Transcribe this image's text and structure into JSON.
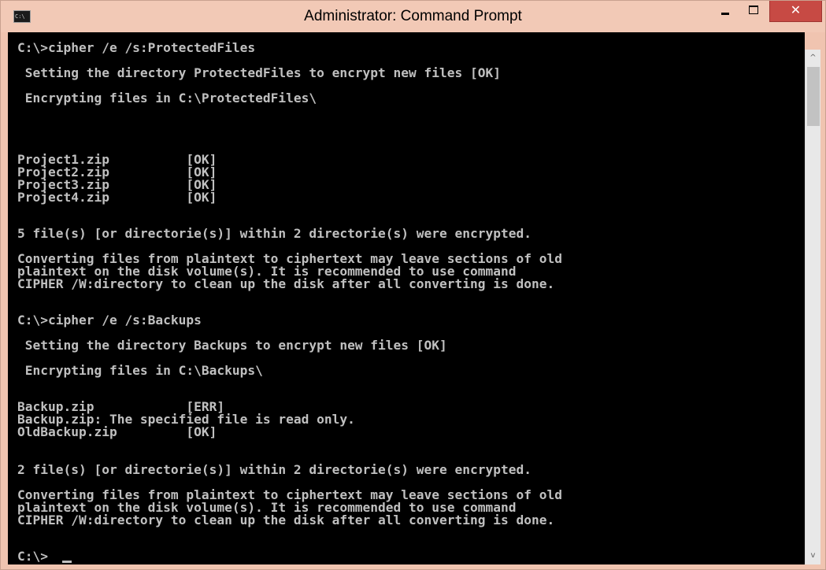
{
  "window": {
    "title": "Administrator: Command Prompt",
    "app_icon_label": "C:\\",
    "minimize_glyph": "–",
    "close_glyph": "✕",
    "icons": {
      "app": "cmd-icon",
      "minimize": "minimize-icon",
      "maximize": "maximize-icon",
      "close": "close-icon",
      "scroll_up": "scroll-up-arrow-icon",
      "scroll_down": "scroll-down-arrow-icon"
    },
    "colors": {
      "titlebar": "#f2c9b6",
      "close_button": "#c74a44",
      "console_background": "#000000",
      "console_text": "#c0c0c0"
    }
  },
  "console": {
    "lines": [
      "C:\\>cipher /e /s:ProtectedFiles",
      "",
      " Setting the directory ProtectedFiles to encrypt new files [OK]",
      "",
      " Encrypting files in C:\\ProtectedFiles\\",
      "",
      "Project1.zip          [OK]",
      "Project2.zip          [OK]",
      "Project3.zip          [OK]",
      "Project4.zip          [OK]",
      "",
      "5 file(s) [or directorie(s)] within 2 directorie(s) were encrypted.",
      "",
      "Converting files from plaintext to ciphertext may leave sections of old",
      "plaintext on the disk volume(s). It is recommended to use command",
      "CIPHER /W:directory to clean up the disk after all converting is done.",
      "",
      "C:\\>cipher /e /s:Backups",
      "",
      " Setting the directory Backups to encrypt new files [OK]",
      "",
      " Encrypting files in C:\\Backups\\",
      "",
      "Backup.zip            [ERR]",
      "Backup.zip: The specified file is read only.",
      "OldBackup.zip         [OK]",
      "",
      "2 file(s) [or directorie(s)] within 2 directorie(s) were encrypted.",
      "",
      "Converting files from plaintext to ciphertext may leave sections of old",
      "plaintext on the disk volume(s). It is recommended to use command",
      "CIPHER /W:directory to clean up the disk after all converting is done.",
      "",
      "C:\\>"
    ]
  },
  "scrollbar": {
    "up_arrow": "^",
    "down_arrow": "v"
  }
}
